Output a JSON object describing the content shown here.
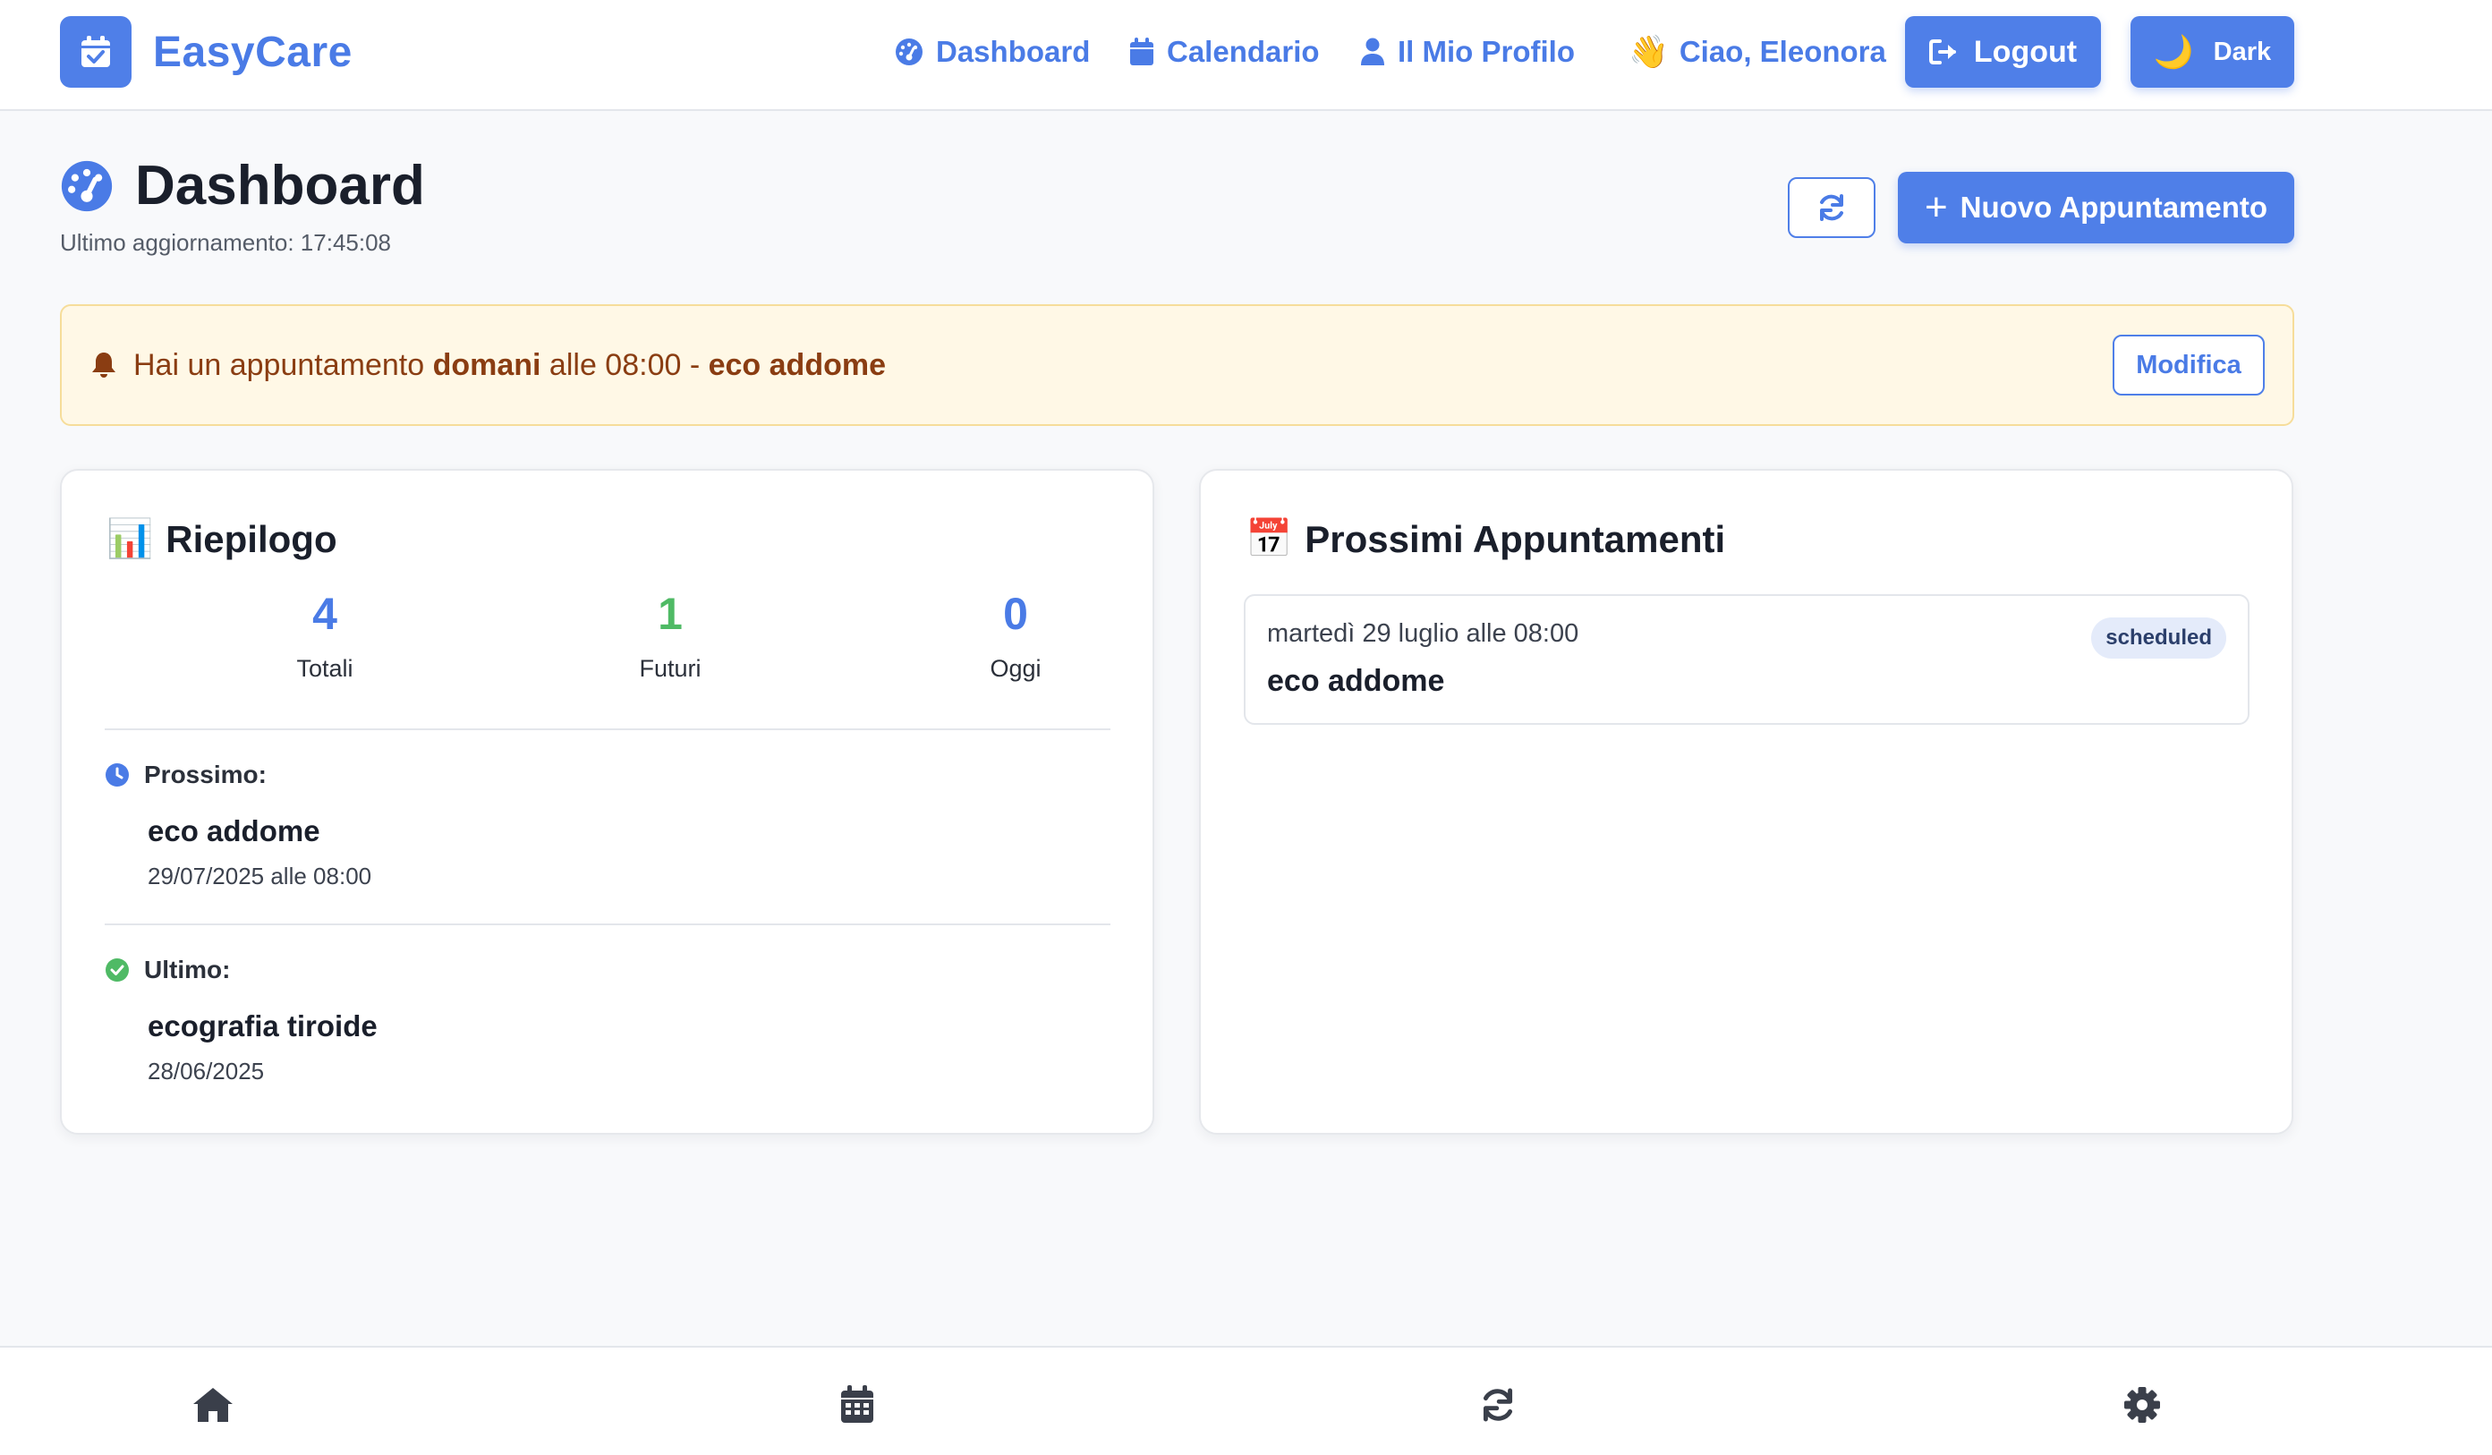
{
  "colors": {
    "accent": "#4f7fe8",
    "accent_text": "#4a7be6",
    "success": "#4fba65",
    "alert_bg": "#fff8e6",
    "alert_text": "#8a3d12"
  },
  "nav": {
    "brand": "EasyCare",
    "links": [
      {
        "label": "Dashboard",
        "icon": "dashboard-icon"
      },
      {
        "label": "Calendario",
        "icon": "calendar-icon"
      },
      {
        "label": "Il Mio Profilo",
        "icon": "user-icon"
      }
    ],
    "greeting_emoji": "👋",
    "greeting": "Ciao, Eleonora",
    "logout_label": "Logout",
    "theme_emoji": "🌙",
    "theme_label": "Dark"
  },
  "header": {
    "title": "Dashboard",
    "last_update": "Ultimo aggiornamento: 17:45:08",
    "new_button_symbol": "+",
    "new_button_label": "Nuovo Appuntamento"
  },
  "alert": {
    "prefix": "Hai un appuntamento ",
    "when_bold": "domani",
    "middle": " alle 08:00 - ",
    "subject_bold": "eco addome",
    "action_label": "Modifica"
  },
  "summary": {
    "emoji": "📊",
    "title": "Riepilogo",
    "stats": [
      {
        "value": "4",
        "label": "Totali"
      },
      {
        "value": "1",
        "label": "Futuri"
      },
      {
        "value": "0",
        "label": "Oggi"
      }
    ],
    "next": {
      "heading": "Prossimo:",
      "name": "eco addome",
      "date": "29/07/2025 alle 08:00"
    },
    "last": {
      "heading": "Ultimo:",
      "name": "ecografia tiroide",
      "date": "28/06/2025"
    }
  },
  "upcoming": {
    "emoji": "📅",
    "title": "Prossimi Appuntamenti",
    "items": [
      {
        "date": "martedì 29 luglio alle 08:00",
        "title": "eco addome",
        "status": "scheduled"
      }
    ]
  },
  "bottom_tabs": [
    "home-icon",
    "calendar-icon",
    "sync-icon",
    "settings-icon"
  ]
}
